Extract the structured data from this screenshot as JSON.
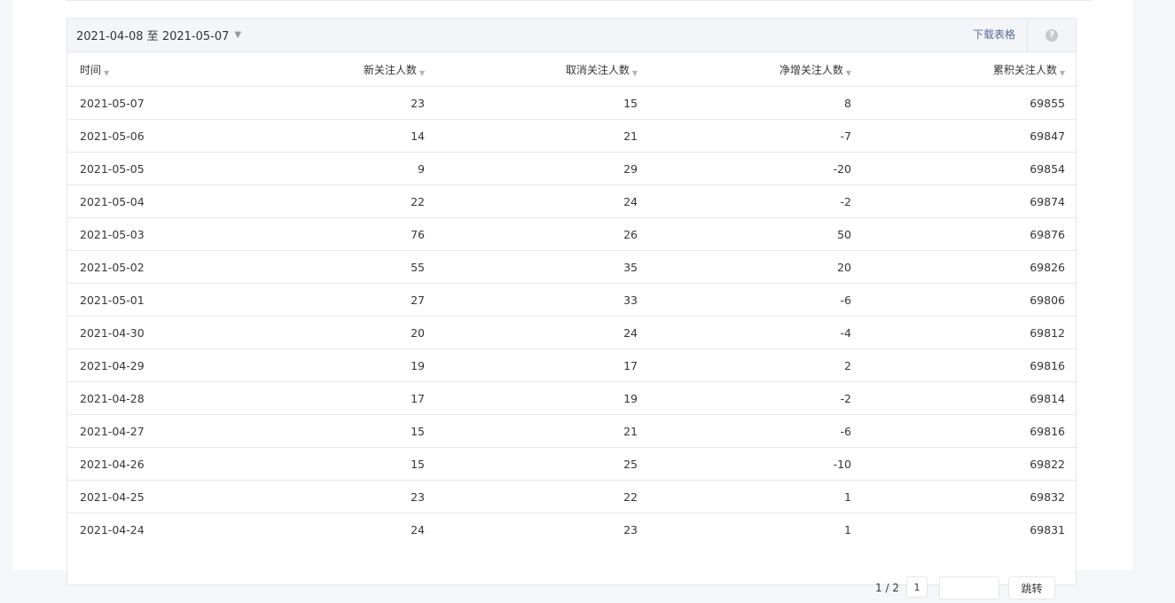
{
  "toolbar": {
    "date_range": "2021-04-08 至 2021-05-07",
    "download_label": "下载表格",
    "help_glyph": "?"
  },
  "table": {
    "headers": [
      "时间",
      "新关注人数",
      "取消关注人数",
      "净增关注人数",
      "累积关注人数"
    ],
    "rows": [
      [
        "2021-05-07",
        "23",
        "15",
        "8",
        "69855"
      ],
      [
        "2021-05-06",
        "14",
        "21",
        "-7",
        "69847"
      ],
      [
        "2021-05-05",
        "9",
        "29",
        "-20",
        "69854"
      ],
      [
        "2021-05-04",
        "22",
        "24",
        "-2",
        "69874"
      ],
      [
        "2021-05-03",
        "76",
        "26",
        "50",
        "69876"
      ],
      [
        "2021-05-02",
        "55",
        "35",
        "20",
        "69826"
      ],
      [
        "2021-05-01",
        "27",
        "33",
        "-6",
        "69806"
      ],
      [
        "2021-04-30",
        "20",
        "24",
        "-4",
        "69812"
      ],
      [
        "2021-04-29",
        "19",
        "17",
        "2",
        "69816"
      ],
      [
        "2021-04-28",
        "17",
        "19",
        "-2",
        "69814"
      ],
      [
        "2021-04-27",
        "15",
        "21",
        "-6",
        "69816"
      ],
      [
        "2021-04-26",
        "15",
        "25",
        "-10",
        "69822"
      ],
      [
        "2021-04-25",
        "23",
        "22",
        "1",
        "69832"
      ],
      [
        "2021-04-24",
        "24",
        "23",
        "1",
        "69831"
      ]
    ]
  },
  "pagination": {
    "page_info": "1 / 2",
    "next_label": "1",
    "jump_label": "跳转",
    "input_value": ""
  },
  "colors": {
    "link": "#576b95",
    "border": "#e6e7eb",
    "header_bg": "#f4f5f9"
  }
}
